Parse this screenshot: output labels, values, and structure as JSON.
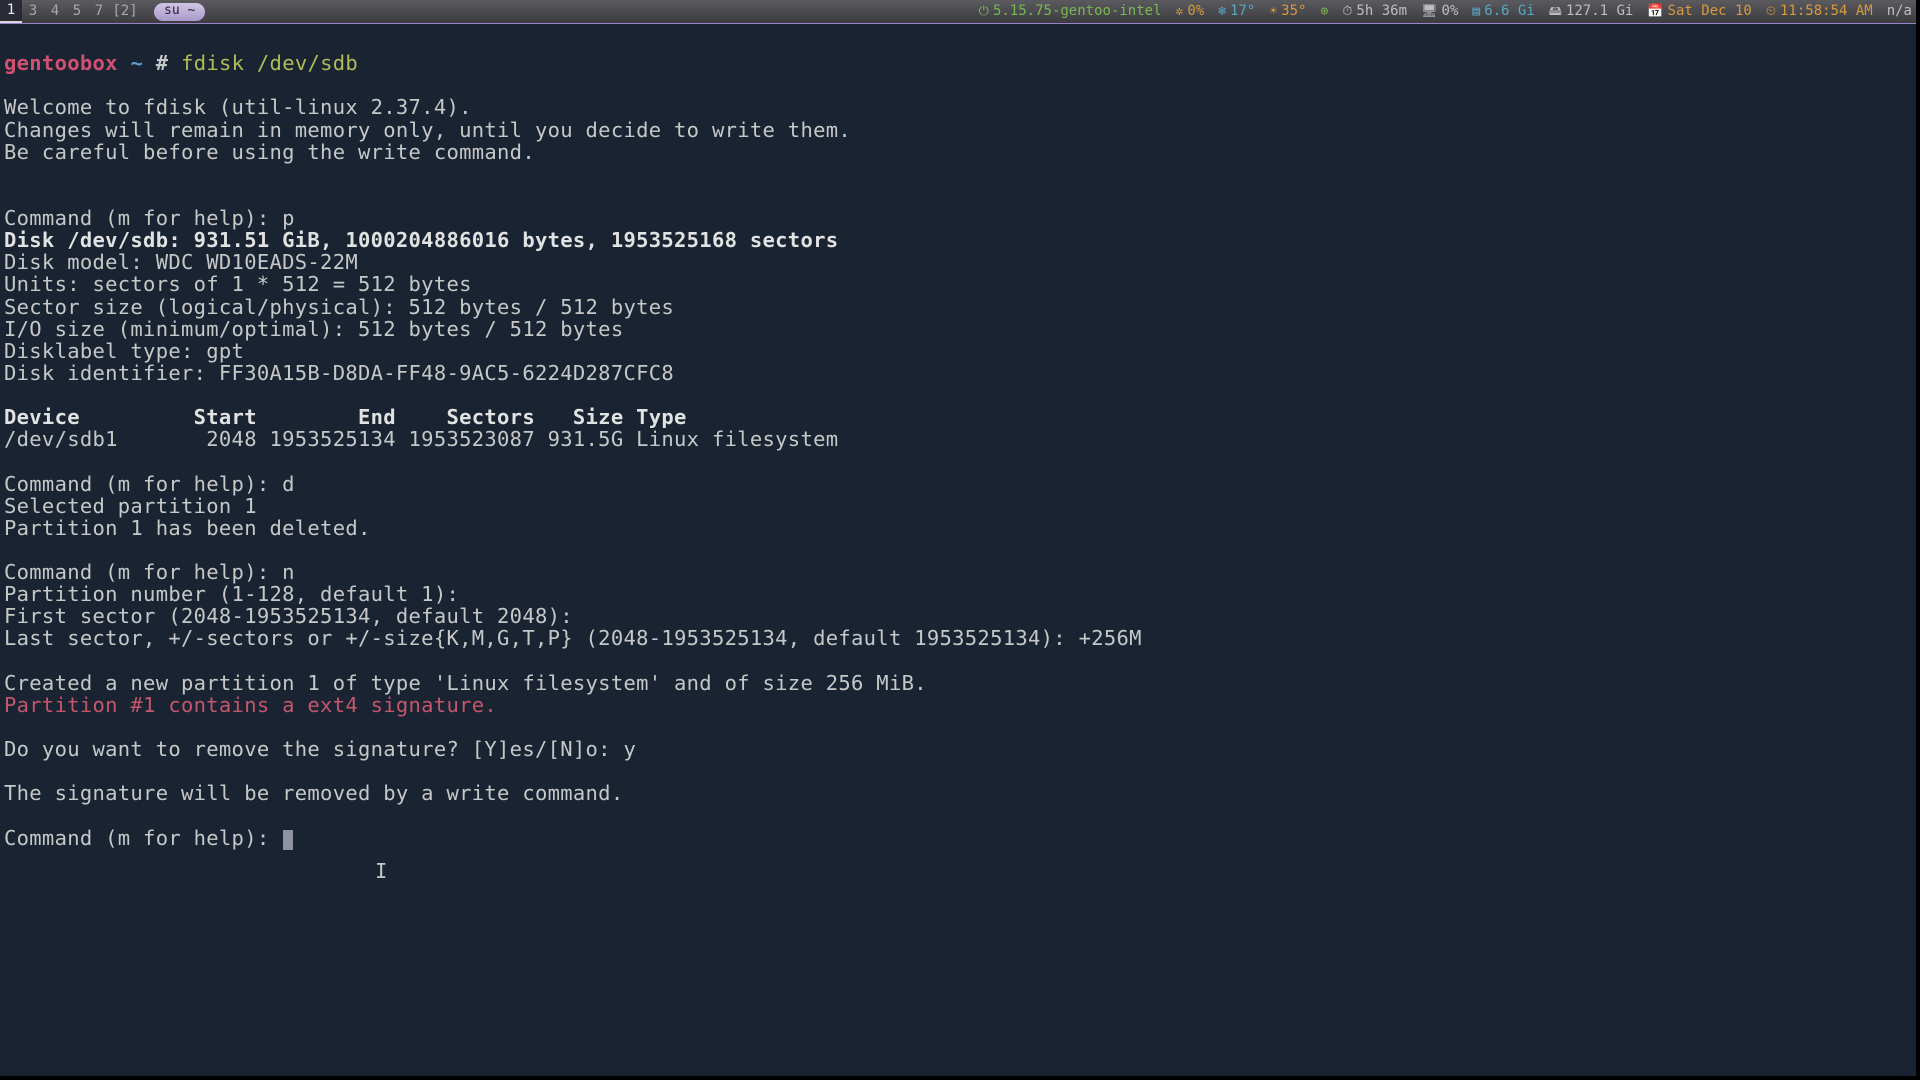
{
  "statusbar": {
    "workspaces": [
      "1",
      "3",
      "4",
      "5",
      "7",
      "[2]"
    ],
    "active_index": 0,
    "title": "su ~",
    "tray": {
      "kernel": {
        "icon": "⏻",
        "text": "5.15.75-gentoo-intel"
      },
      "fan": {
        "icon": "✲",
        "text": "0%"
      },
      "temp1": {
        "icon": "❄",
        "text": "17°"
      },
      "temp2": {
        "icon": "☀",
        "text": "35°"
      },
      "net": {
        "icon": "⊕",
        "text": ""
      },
      "uptime": {
        "icon": "⏱",
        "text": "5h 36m"
      },
      "battery": {
        "icon": "🖥",
        "text": "0%"
      },
      "mem": {
        "icon": "▤",
        "text": "6.6 Gi"
      },
      "disk": {
        "icon": "🖴",
        "text": "127.1 Gi"
      },
      "date": {
        "icon": "📅",
        "text": "Sat Dec 10"
      },
      "time": {
        "icon": "⏲",
        "text": "11:58:54 AM"
      },
      "extra": {
        "text": "n/a"
      }
    }
  },
  "prompt": {
    "host": "gentoobox",
    "path": "~",
    "sigil": "#",
    "command": "fdisk /dev/sdb"
  },
  "out": {
    "welcome1": "Welcome to fdisk (util-linux 2.37.4).",
    "welcome2": "Changes will remain in memory only, until you decide to write them.",
    "welcome3": "Be careful before using the write command.",
    "cmdp": "Command (m for help): p",
    "diskline": "Disk /dev/sdb: 931.51 GiB, 1000204886016 bytes, 1953525168 sectors",
    "model": "Disk model: WDC WD10EADS-22M",
    "units": "Units: sectors of 1 * 512 = 512 bytes",
    "sector": "Sector size (logical/physical): 512 bytes / 512 bytes",
    "io": "I/O size (minimum/optimal): 512 bytes / 512 bytes",
    "label": "Disklabel type: gpt",
    "ident": "Disk identifier: FF30A15B-D8DA-FF48-9AC5-6224D287CFC8",
    "tblhead": "Device         Start        End    Sectors   Size Type",
    "tblrow": "/dev/sdb1       2048 1953525134 1953523087 931.5G Linux filesystem",
    "cmdd": "Command (m for help): d",
    "sel1": "Selected partition 1",
    "deleted": "Partition 1 has been deleted.",
    "cmdn": "Command (m for help): n",
    "pnum": "Partition number (1-128, default 1): ",
    "first": "First sector (2048-1953525134, default 2048): ",
    "last": "Last sector, +/-sectors or +/-size{K,M,G,T,P} (2048-1953525134, default 1953525134): +256M",
    "created": "Created a new partition 1 of type 'Linux filesystem' and of size 256 MiB.",
    "sigwarn": "Partition #1 contains a ext4 signature.",
    "ask": "Do you want to remove the signature? [Y]es/[N]o: y",
    "removed": "The signature will be removed by a write command.",
    "cmdwait": "Command (m for help): "
  }
}
